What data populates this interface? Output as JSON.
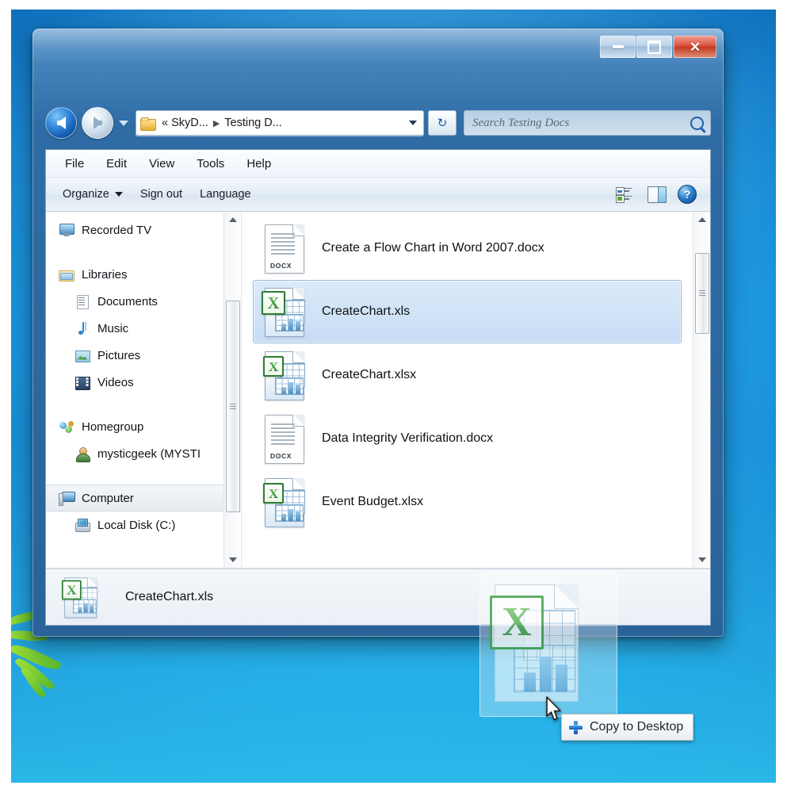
{
  "window": {
    "caption": {
      "minimize_label": "Minimize",
      "maximize_label": "Maximize",
      "close_label": "Close",
      "close_glyph": "✕"
    }
  },
  "address_bar": {
    "back_label": "Back",
    "forward_label": "Forward",
    "recent_label": "Recent pages",
    "crumbs": [
      "«",
      "SkyD...",
      "Testing D..."
    ],
    "separator": "▶",
    "refresh_glyph": "↻",
    "refresh_label": "Refresh"
  },
  "search": {
    "placeholder": "Search Testing Docs",
    "value": ""
  },
  "menubar": {
    "items": [
      "File",
      "Edit",
      "View",
      "Tools",
      "Help"
    ]
  },
  "toolbar": {
    "organize_label": "Organize",
    "sign_out_label": "Sign out",
    "language_label": "Language",
    "change_view_label": "Change your view",
    "preview_pane_label": "Show the preview pane",
    "help_label": "Get help",
    "help_glyph": "?"
  },
  "navpane": {
    "items": [
      {
        "label": "Recorded TV",
        "icon": "monitor-icon",
        "indent": false,
        "selected": false
      },
      {
        "label": "Libraries",
        "icon": "library-folder-icon",
        "indent": false,
        "selected": false
      },
      {
        "label": "Documents",
        "icon": "documents-icon",
        "indent": true,
        "selected": false
      },
      {
        "label": "Music",
        "icon": "music-note-icon",
        "indent": true,
        "selected": false
      },
      {
        "label": "Pictures",
        "icon": "picture-icon",
        "indent": true,
        "selected": false
      },
      {
        "label": "Videos",
        "icon": "video-icon",
        "indent": true,
        "selected": false
      },
      {
        "label": "Homegroup",
        "icon": "homegroup-icon",
        "indent": false,
        "selected": false
      },
      {
        "label": "mysticgeek (MYSTI",
        "icon": "user-icon",
        "indent": true,
        "selected": false
      },
      {
        "label": "Computer",
        "icon": "computer-icon",
        "indent": false,
        "selected": true
      },
      {
        "label": "Local Disk (C:)",
        "icon": "hard-disk-icon",
        "indent": true,
        "selected": false
      }
    ]
  },
  "files": [
    {
      "name": "Create a Flow Chart in Word 2007.docx",
      "type": "docx",
      "badge": "DOCX",
      "selected": false
    },
    {
      "name": "CreateChart.xls",
      "type": "xls",
      "badge": "",
      "selected": true
    },
    {
      "name": "CreateChart.xlsx",
      "type": "xlsx",
      "badge": "",
      "selected": false
    },
    {
      "name": "Data Integrity Verification.docx",
      "type": "docx",
      "badge": "DOCX",
      "selected": false
    },
    {
      "name": "Event Budget.xlsx",
      "type": "xlsx",
      "badge": "",
      "selected": false
    }
  ],
  "details_pane": {
    "file_name": "CreateChart.xls"
  },
  "drag": {
    "tooltip_text": "Copy to Desktop",
    "ghost_file": "CreateChart.xls",
    "cursor_label": "mouse-pointer"
  },
  "colors": {
    "title_bar": "#2f6ca5",
    "desktop_top": "#1469b5",
    "desktop_bottom": "#2fc1f2",
    "selection_fill": "#cfe2f7",
    "selection_border": "#8fb8de",
    "close_button": "#c43a22",
    "excel_green": "#2e7d32",
    "accent_blue": "#1359b8"
  }
}
